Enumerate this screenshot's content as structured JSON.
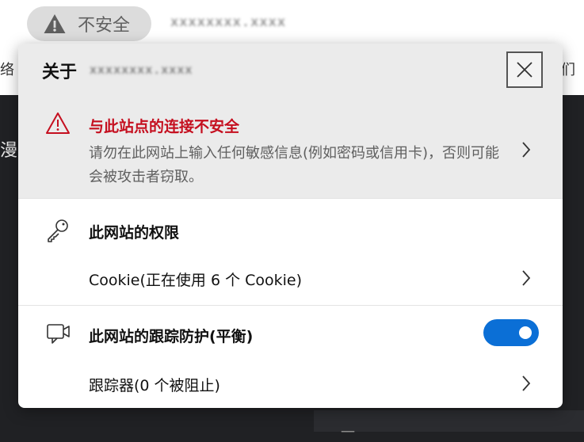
{
  "address_bar": {
    "security_label": "不安全",
    "url_obscured": "xxxxxxxx.xxxx"
  },
  "popup": {
    "title_prefix": "关于",
    "title_site_obscured": "xxxxxxxx.xxxx",
    "warning": {
      "title": "与此站点的连接不安全",
      "description": "请勿在此网站上输入任何敏感信息(例如密码或信用卡)，否则可能会被攻击者窃取。"
    },
    "permissions": {
      "title": "此网站的权限",
      "cookie_label": "Cookie(正在使用 6 个 Cookie)"
    },
    "tracking": {
      "title": "此网站的跟踪防护(平衡)",
      "toggle_on": true,
      "trackers_label": "跟踪器(0 个被阻止)"
    }
  },
  "background": {
    "left_fragment": "络",
    "right_fragment": "们",
    "side_fragment": "漫",
    "bottom_fragment": "一"
  },
  "colors": {
    "warning_red": "#c50f1f",
    "toggle_blue": "#0b6fd6",
    "panel_gray": "#ebebeb"
  }
}
